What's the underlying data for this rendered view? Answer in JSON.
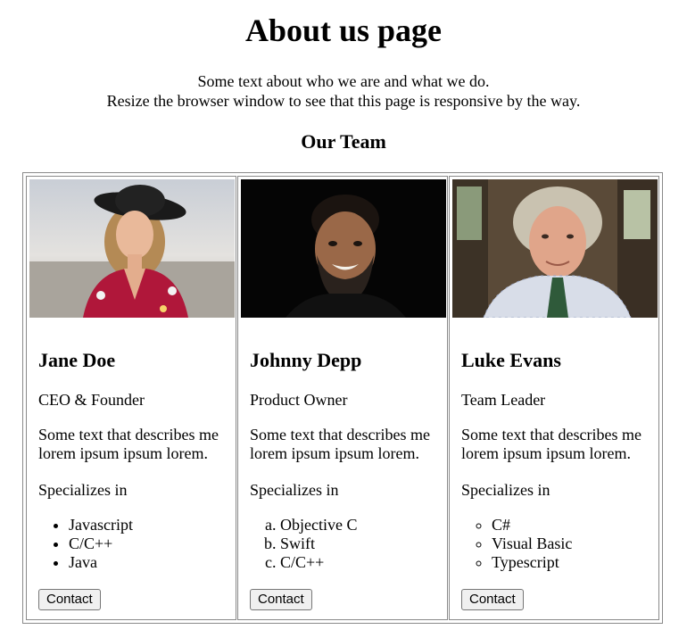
{
  "header": {
    "title": "About us page",
    "intro_line1": "Some text about who we are and what we do.",
    "intro_line2": "Resize the browser window to see that this page is responsive by the way."
  },
  "team": {
    "heading": "Our Team",
    "members": [
      {
        "name": "Jane Doe",
        "role": "CEO & Founder",
        "description": "Some text that describes me lorem ipsum ipsum lorem.",
        "specializes_label": "Specializes in",
        "list_style": "disc",
        "skills": [
          "Javascript",
          "C/C++",
          "Java"
        ],
        "contact_label": "Contact"
      },
      {
        "name": "Johnny Depp",
        "role": "Product Owner",
        "description": "Some text that describes me lorem ipsum ipsum lorem.",
        "specializes_label": "Specializes in",
        "list_style": "lower-alpha",
        "skills": [
          "Objective C",
          "Swift",
          "C/C++"
        ],
        "contact_label": "Contact"
      },
      {
        "name": "Luke Evans",
        "role": "Team Leader",
        "description": "Some text that describes me lorem ipsum ipsum lorem.",
        "specializes_label": "Specializes in",
        "list_style": "circle",
        "skills": [
          "C#",
          "Visual Basic",
          "Typescript"
        ],
        "contact_label": "Contact"
      }
    ]
  },
  "colors": {
    "border": "#8a8a8a",
    "button_bg": "#f0f0f0"
  }
}
